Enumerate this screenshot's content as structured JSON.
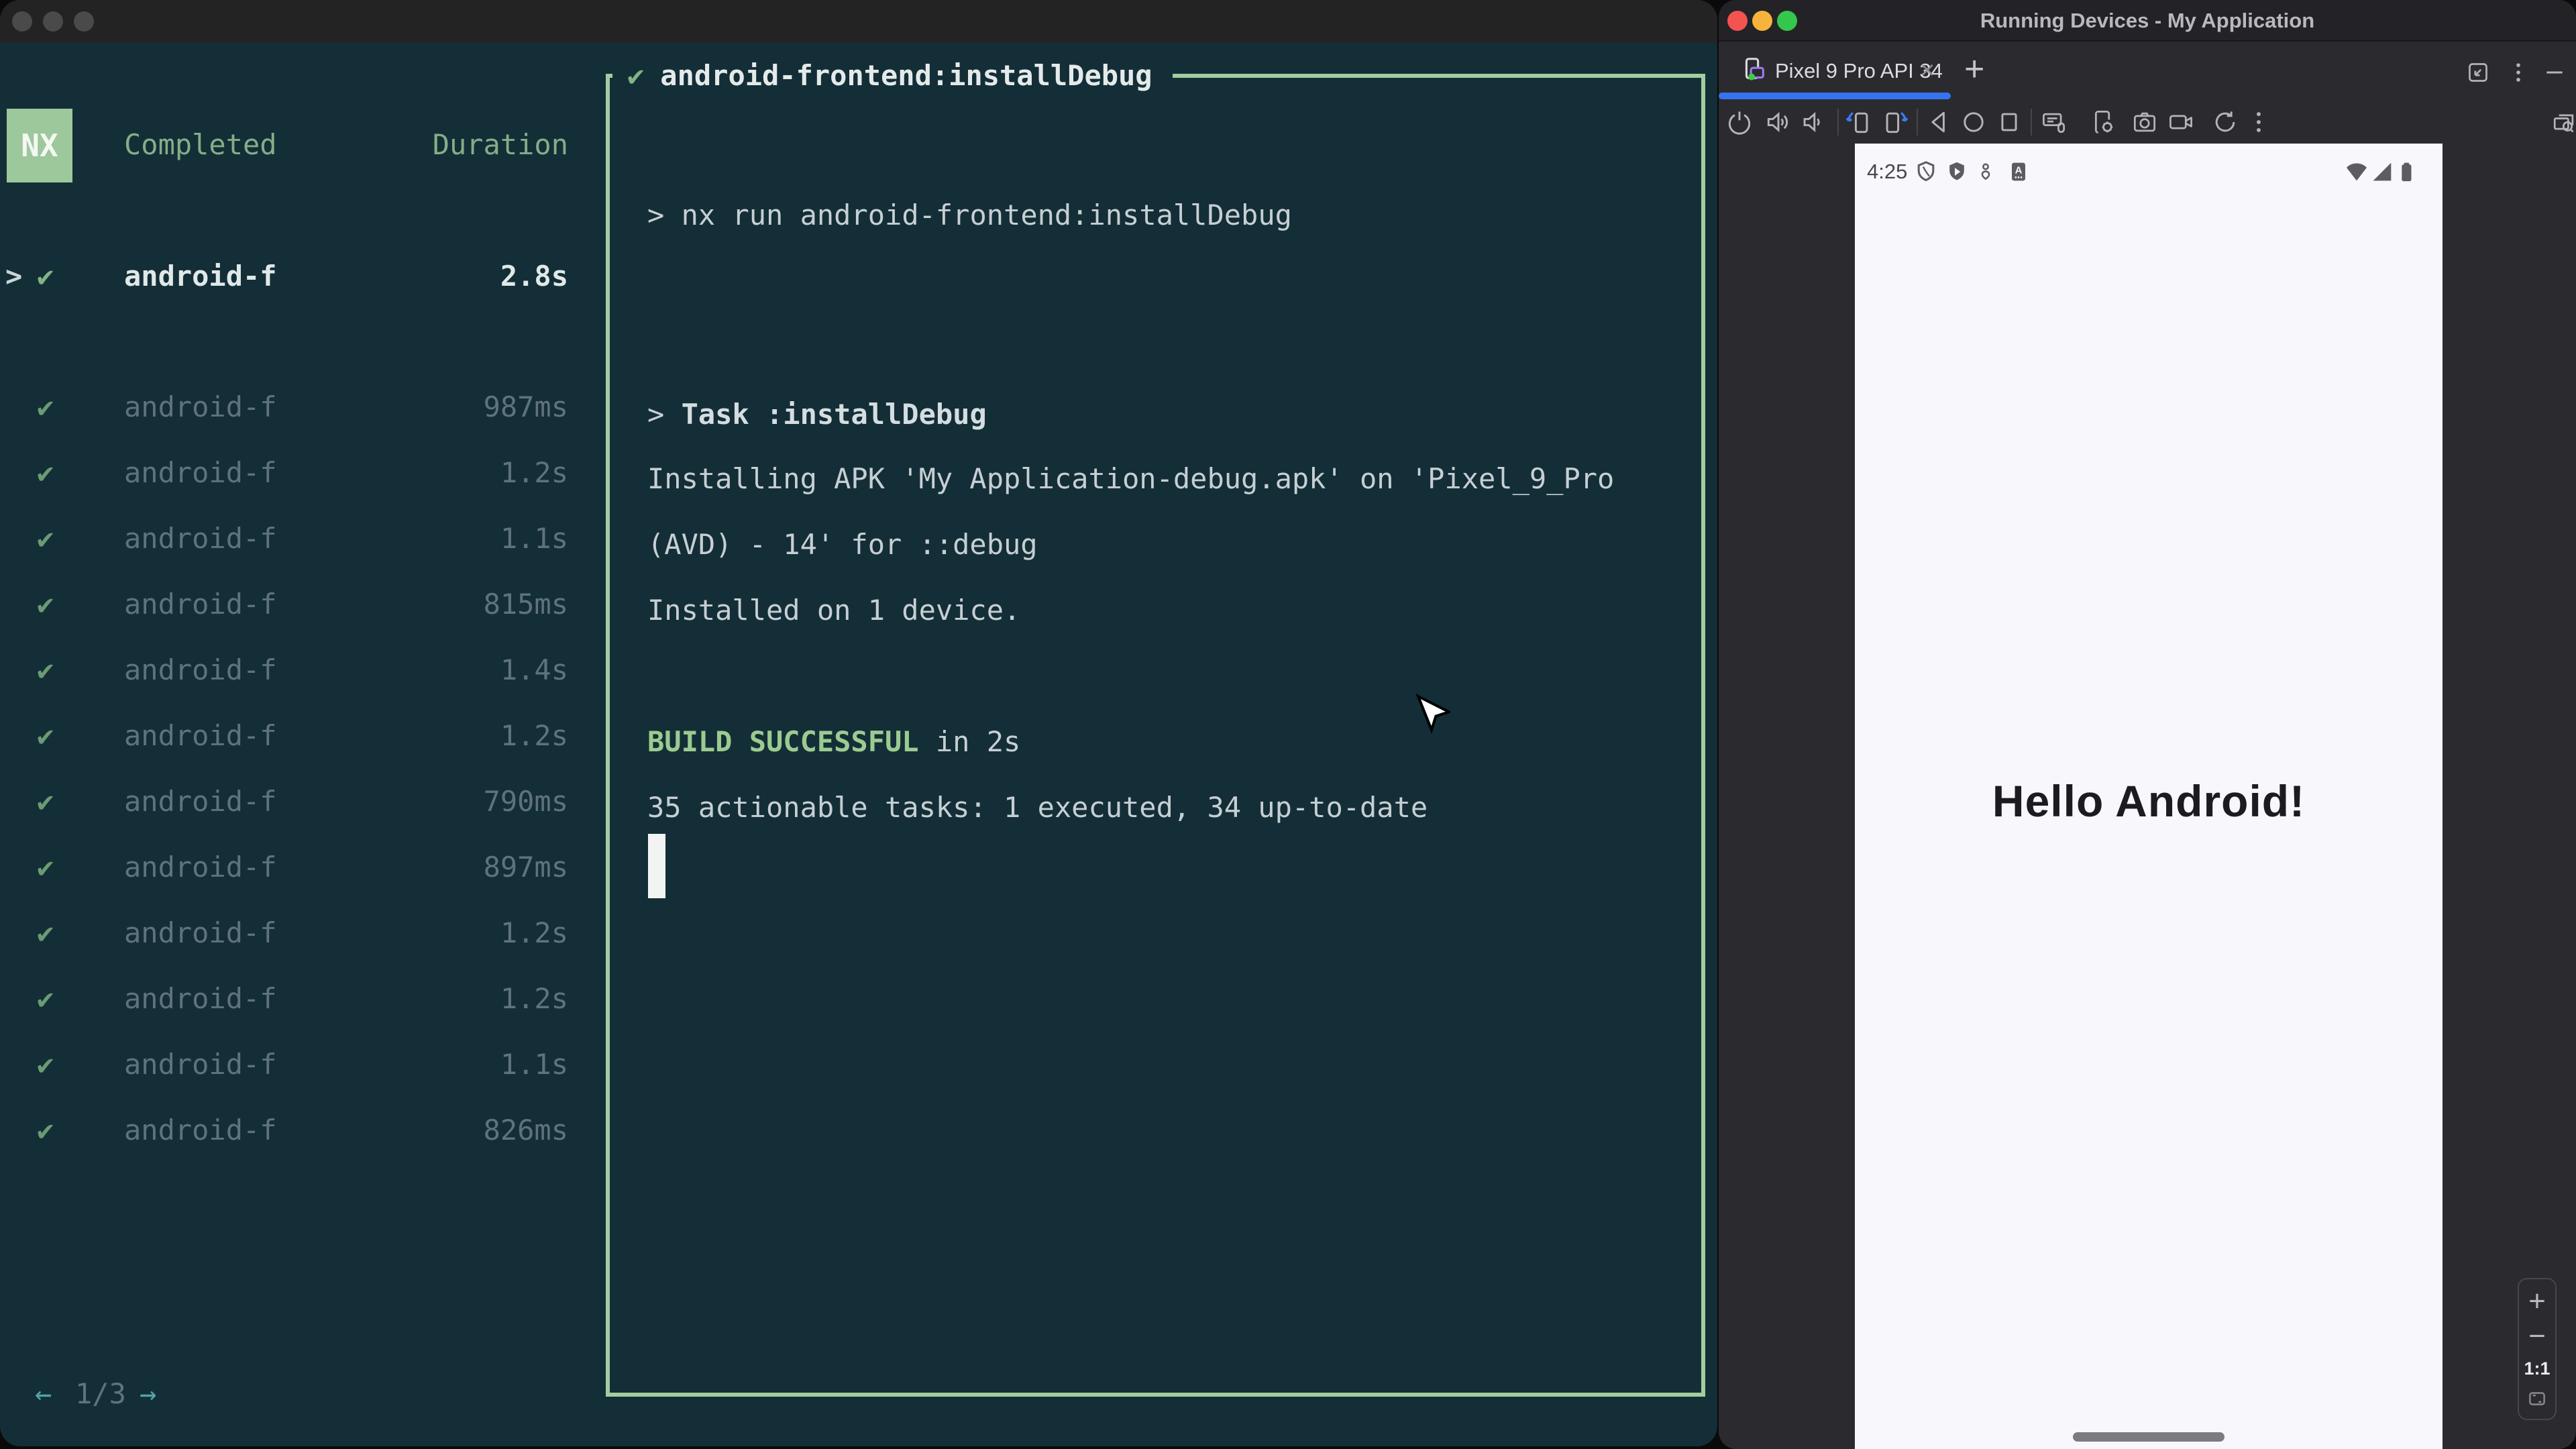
{
  "colors": {
    "terminal_bg": "#142e37",
    "accent_green": "#9cc89b",
    "box_border_green": "#a2cd9e",
    "success_green": "#9bcb90",
    "dim_text": "#5e737c",
    "bright_text": "#e1e8e8",
    "teal_arrows": "#55a3a8",
    "studio_bg": "#2b2b2f",
    "active_tab_blue": "#3574f0",
    "phone_screen_bg": "#f8f7fb"
  },
  "terminal": {
    "tasks_panel": {
      "logo_text": "NX",
      "check_icon": "✔",
      "header": {
        "completed": "Completed",
        "duration": "Duration"
      },
      "selected_task": {
        "expand_icon": ">",
        "name": "android-f",
        "duration": "2.8s"
      },
      "tasks": [
        {
          "name": "android-f",
          "duration": "987ms"
        },
        {
          "name": "android-f",
          "duration": "1.2s"
        },
        {
          "name": "android-f",
          "duration": "1.1s"
        },
        {
          "name": "android-f",
          "duration": "815ms"
        },
        {
          "name": "android-f",
          "duration": "1.4s"
        },
        {
          "name": "android-f",
          "duration": "1.2s"
        },
        {
          "name": "android-f",
          "duration": "790ms"
        },
        {
          "name": "android-f",
          "duration": "897ms"
        },
        {
          "name": "android-f",
          "duration": "1.2s"
        },
        {
          "name": "android-f",
          "duration": "1.2s"
        },
        {
          "name": "android-f",
          "duration": "1.1s"
        },
        {
          "name": "android-f",
          "duration": "826ms"
        }
      ],
      "pagination": {
        "prev_icon": "←",
        "current": "1/3",
        "next_icon": "→"
      }
    },
    "output_panel": {
      "header_check_icon": "✔",
      "header_title": "android-frontend:installDebug",
      "command_prompt": ">",
      "command": "nx run android-frontend:installDebug",
      "task_prompt": "> ",
      "task": "Task :installDebug",
      "log1": "Installing APK 'My Application-debug.apk' on 'Pixel_9_Pro",
      "log2": "(AVD) - 14' for ::debug",
      "log3": "Installed on 1 device.",
      "build_status": "BUILD SUCCESSFUL",
      "build_rest": " in 2s",
      "summary": "35 actionable tasks: 1 executed, 34 up-to-date"
    }
  },
  "studio": {
    "window_title": "Running Devices - My Application",
    "tab": {
      "label": "Pixel 9 Pro API 34",
      "close_icon": "×",
      "new_tab_icon": "+"
    },
    "tab_action_icons": [
      "embed-window-icon",
      "more-options-icon",
      "hide-icon"
    ],
    "toolbar_icons": [
      "power-icon",
      "volume-up-icon",
      "volume-down-icon",
      "rotate-left-icon",
      "rotate-right-icon",
      "back-icon",
      "home-icon",
      "overview-icon",
      "snippets-icon",
      "device-settings-icon",
      "screenshot-icon",
      "screen-record-icon",
      "restart-icon",
      "more-icon",
      "layout-inspector-icon"
    ],
    "emulator": {
      "status_time": "4:25",
      "status_left_icons": [
        "shield-icon",
        "play-protect-icon",
        "profile-icon",
        "api-badge-icon"
      ],
      "status_right_icons": [
        "wifi-icon",
        "cellular-icon",
        "battery-icon"
      ],
      "screen_text": "Hello Android!"
    },
    "zoom_controls": {
      "zoom_in": "+",
      "zoom_out": "−",
      "actual_size": "1:1",
      "fit_icon": "fit-to-window-icon"
    }
  }
}
